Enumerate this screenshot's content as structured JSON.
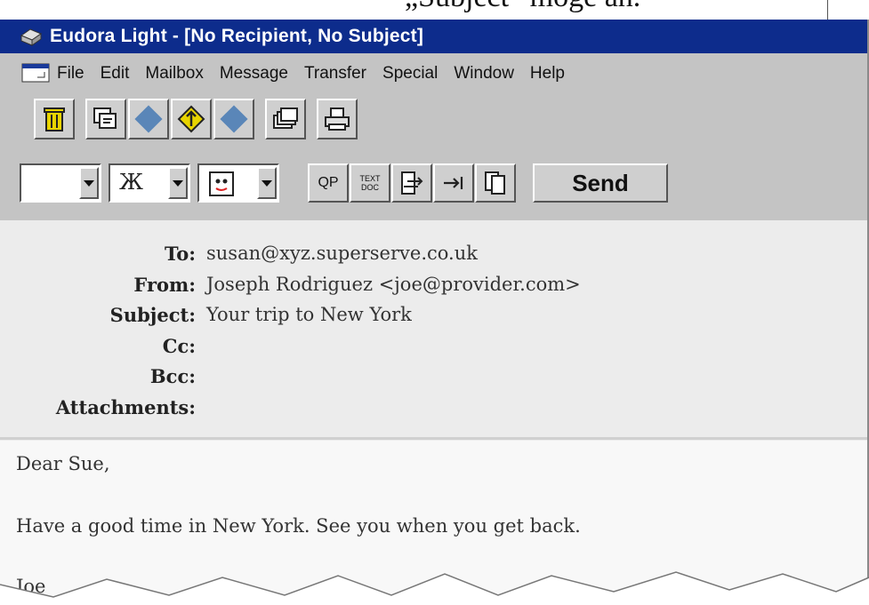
{
  "page_caption": "„Subject“ möge an.",
  "window": {
    "title": "Eudora Light - [No Recipient, No Subject]"
  },
  "menu": {
    "items": [
      "File",
      "Edit",
      "Mailbox",
      "Message",
      "Transfer",
      "Special",
      "Window",
      "Help"
    ]
  },
  "toolbar1": {
    "icons": [
      "trash-icon",
      "reply-icon",
      "prev-message-icon",
      "attach-icon",
      "next-message-icon",
      "stack-icon",
      "print-icon"
    ]
  },
  "toolbar2": {
    "signature_label": "Ж",
    "buttons": [
      "QP",
      "TEXT DOC",
      "wrap-icon",
      "tab-icon",
      "copy-icon"
    ],
    "send_label": "Send"
  },
  "headers": {
    "to_label": "To:",
    "to_value": "susan@xyz.superserve.co.uk",
    "from_label": "From:",
    "from_value": "Joseph Rodriguez <joe@provider.com>",
    "subject_label": "Subject:",
    "subject_value": "Your trip to New York",
    "cc_label": "Cc:",
    "cc_value": "",
    "bcc_label": "Bcc:",
    "bcc_value": "",
    "attachments_label": "Attachments:",
    "attachments_value": ""
  },
  "body": {
    "line1": "Dear Sue,",
    "line2": "Have a good time in New York. See you when you get back.",
    "line3": "Joe"
  },
  "colors": {
    "titlebar": "#0d2c8c",
    "window_bg": "#c4c4c4",
    "accent_diamond": "#5a86b8"
  }
}
